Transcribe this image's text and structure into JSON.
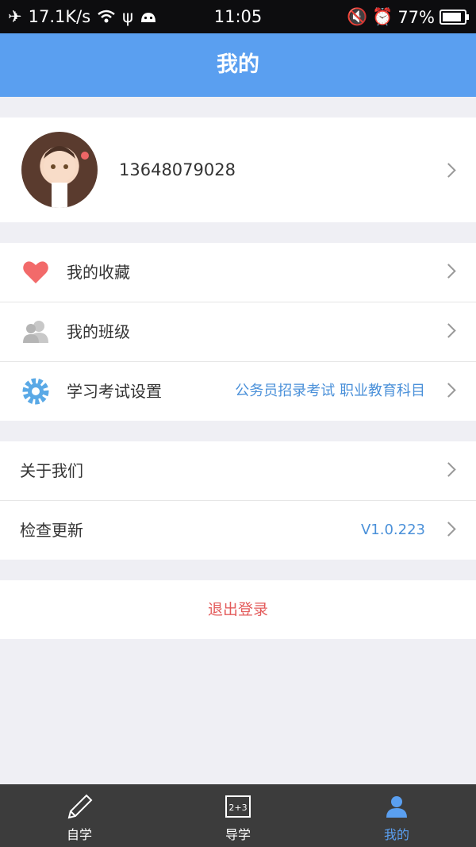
{
  "status_bar": {
    "speed": "17.1K/s",
    "time": "11:05",
    "battery": "77%",
    "battery_level": 0.77
  },
  "header": {
    "title": "我的"
  },
  "profile": {
    "phone": "13648079028"
  },
  "menu": {
    "favorites": "我的收藏",
    "my_class": "我的班级",
    "exam_settings": "学习考试设置",
    "exam_settings_value": "公务员招录考试 职业教育科目"
  },
  "info": {
    "about": "关于我们",
    "check_update": "检查更新",
    "version": "V1.0.223"
  },
  "logout": "退出登录",
  "tabs": [
    {
      "label": "自学",
      "icon": "pencil-icon",
      "active": false
    },
    {
      "label": "导学",
      "icon": "board-icon",
      "active": false
    },
    {
      "label": "我的",
      "icon": "person-icon",
      "active": true
    }
  ],
  "colors": {
    "primary": "#5a9ff0",
    "logout": "#e35b5b",
    "heart": "#f26a6a",
    "tabbar": "#3c3c3c"
  }
}
